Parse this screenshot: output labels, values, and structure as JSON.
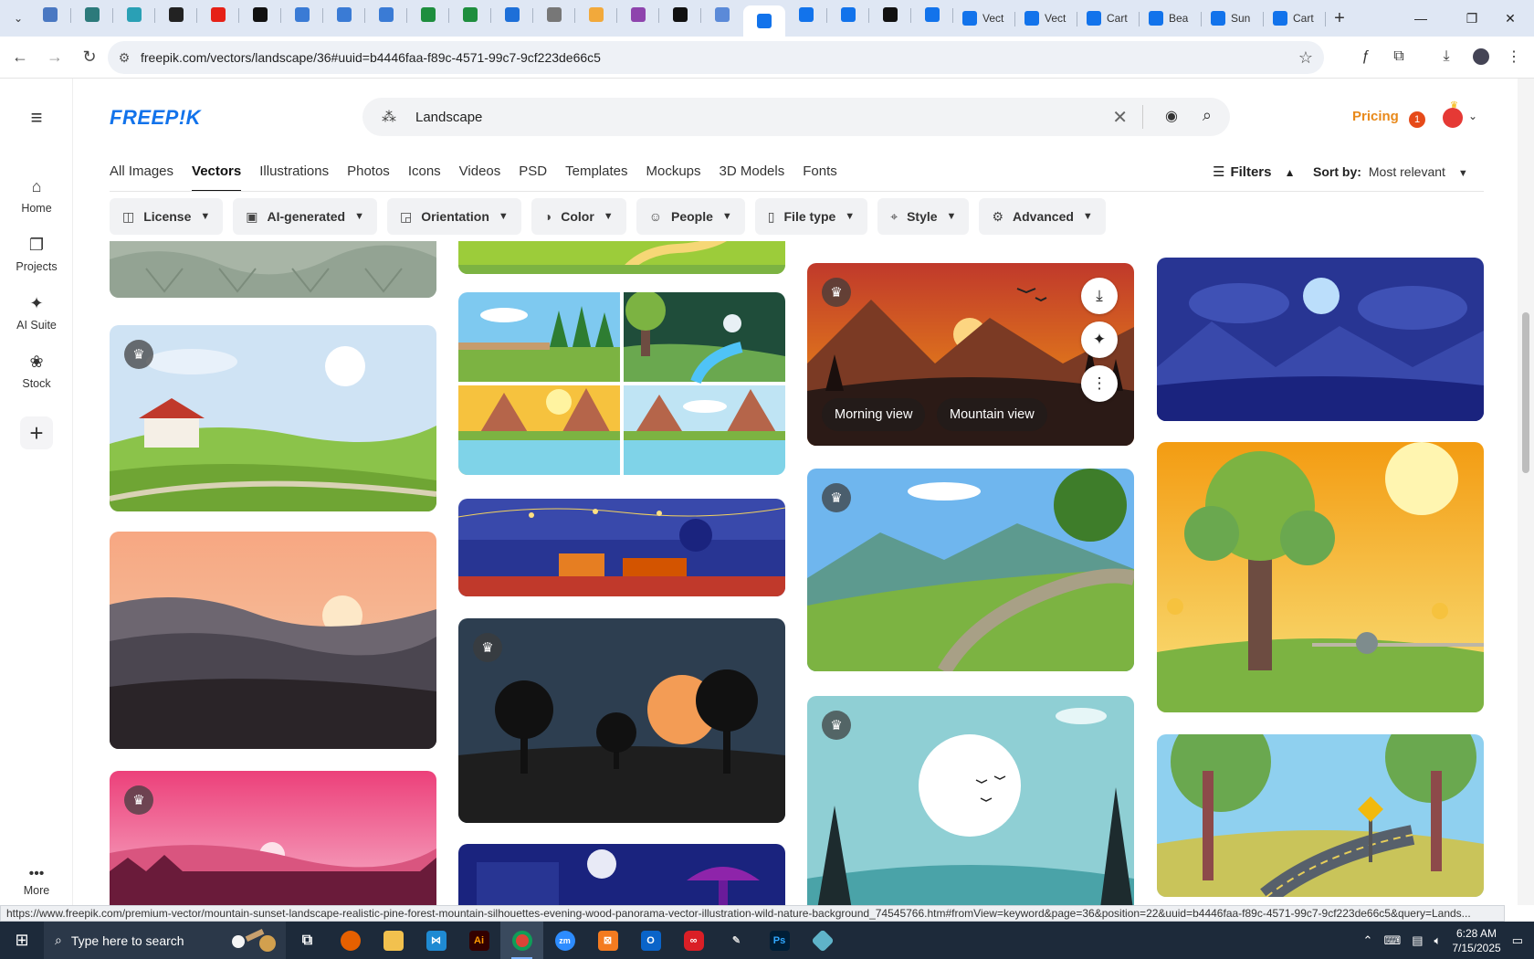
{
  "browser": {
    "tabs": [
      {
        "fav": "#4a78c2",
        "label": ""
      },
      {
        "fav": "#2c7a7b",
        "label": ""
      },
      {
        "fav": "#2aa0b5",
        "label": ""
      },
      {
        "fav": "#222222",
        "label": ""
      },
      {
        "fav": "#e62117",
        "label": ""
      },
      {
        "fav": "#111111",
        "label": ""
      },
      {
        "fav": "#3a7bd5",
        "label": ""
      },
      {
        "fav": "#3a7bd5",
        "label": ""
      },
      {
        "fav": "#3a7bd5",
        "label": ""
      },
      {
        "fav": "#1e8e3e",
        "label": ""
      },
      {
        "fav": "#1e8e3e",
        "label": ""
      },
      {
        "fav": "#1d6fd8",
        "label": ""
      },
      {
        "fav": "#777777",
        "label": ""
      },
      {
        "fav": "#f2a93b",
        "label": ""
      },
      {
        "fav": "#8e44ad",
        "label": ""
      },
      {
        "fav": "#111111",
        "label": ""
      },
      {
        "fav": "#5b8ad8",
        "label": ""
      },
      {
        "fav": "#1273eb",
        "label": ""
      },
      {
        "fav": "#1273eb",
        "label": ""
      },
      {
        "fav": "#1273eb",
        "label": ""
      },
      {
        "fav": "#111111",
        "label": ""
      },
      {
        "fav": "#1273eb",
        "label": ""
      }
    ],
    "wide_tabs": [
      {
        "fav": "#1273eb",
        "label": "Vect"
      },
      {
        "fav": "#1273eb",
        "label": "Vect"
      },
      {
        "fav": "#1273eb",
        "label": "Cart"
      },
      {
        "fav": "#1273eb",
        "label": "Bea"
      },
      {
        "fav": "#1273eb",
        "label": "Sun"
      },
      {
        "fav": "#1273eb",
        "label": "Cart"
      }
    ],
    "url": "freepik.com/vectors/landscape/36#uuid=b4446faa-f89c-4571-99c7-9cf223de66c5",
    "status_url": "https://www.freepik.com/premium-vector/mountain-sunset-landscape-realistic-pine-forest-mountain-silhouettes-evening-wood-panorama-vector-illustration-wild-nature-background_74545766.htm#fromView=keyword&page=36&position=22&uuid=b4446faa-f89c-4571-99c7-9cf223de66c5&query=Lands..."
  },
  "site": {
    "logo": "FREEP!K",
    "search": {
      "value": "Landscape",
      "placeholder": "Search"
    },
    "pricing": "Pricing",
    "notif_count": "1",
    "sidebar": [
      {
        "icon": "home-icon",
        "label": "Home"
      },
      {
        "icon": "projects-icon",
        "label": "Projects"
      },
      {
        "icon": "ai-suite-icon",
        "label": "AI Suite"
      },
      {
        "icon": "stock-icon",
        "label": "Stock"
      }
    ],
    "more": "More",
    "categories": [
      "All Images",
      "Vectors",
      "Illustrations",
      "Photos",
      "Icons",
      "Videos",
      "PSD",
      "Templates",
      "Mockups",
      "3D Models",
      "Fonts"
    ],
    "active_category": "Vectors",
    "filters_label": "Filters",
    "sort_label": "Sort by:",
    "sort_value": "Most relevant",
    "chips": [
      "License",
      "AI-generated",
      "Orientation",
      "Color",
      "People",
      "File type",
      "Style",
      "Advanced"
    ]
  },
  "card_tags": [
    "Morning view",
    "Mountain view"
  ],
  "taskbar": {
    "search_placeholder": "Type here to search",
    "time": "6:28 AM",
    "date": "7/15/2025"
  }
}
